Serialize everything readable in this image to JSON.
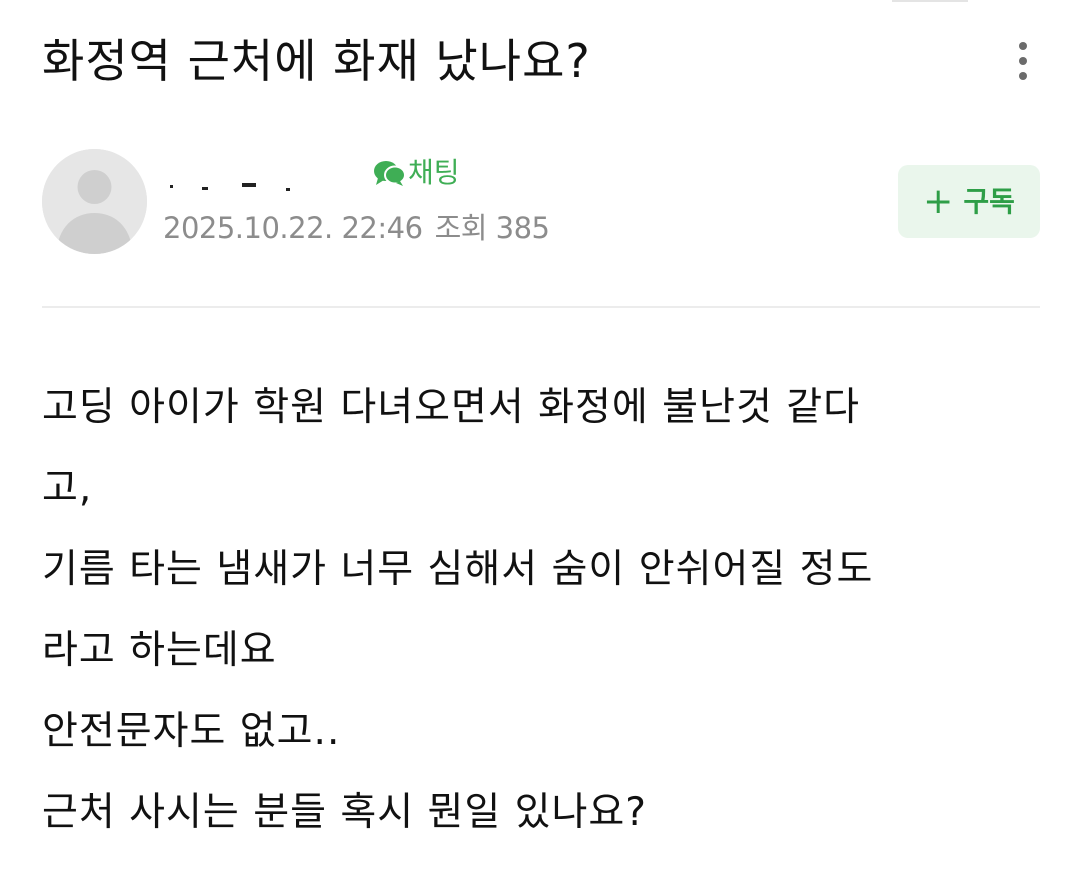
{
  "post": {
    "title": "화정역 근처에 화재 났나요?",
    "author": {
      "chat_label": "채팅",
      "date": "2025.10.22. 22:46",
      "views_label": "조회",
      "views": "385"
    },
    "subscribe_label": "구독",
    "body_lines": [
      "고딩 아이가 학원 다녀오면서 화정에 불난것 같다",
      "고,",
      "기름 타는 냄새가 너무 심해서 숨이 안쉬어질 정도",
      "라고 하는데요",
      "안전문자도 없고..",
      "근처 사시는 분들 혹시 뭔일 있나요?"
    ]
  },
  "icons": {
    "more": "more-vertical-icon",
    "chat": "chat-bubble-icon",
    "avatar": "default-user-icon",
    "plus": "plus-icon"
  },
  "colors": {
    "accent_green": "#3fae55",
    "subscribe_bg": "#eaf6ec",
    "meta_gray": "#8c8c8c",
    "text": "#111111"
  }
}
